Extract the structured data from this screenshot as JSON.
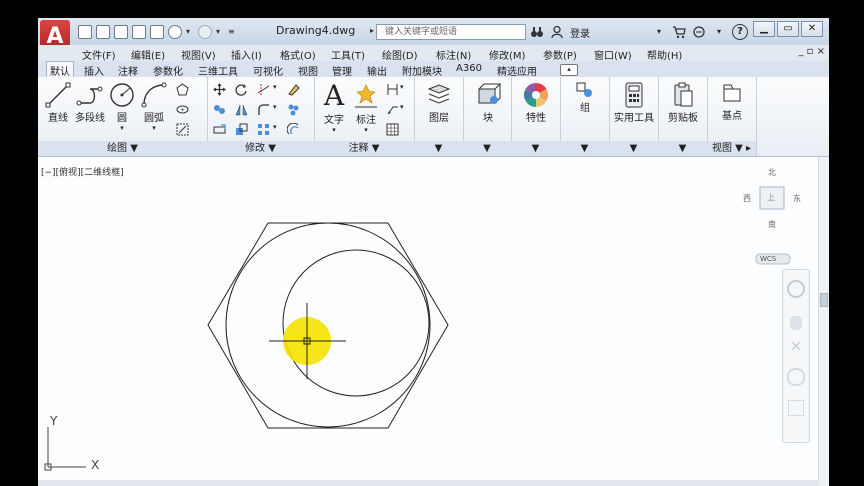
{
  "app": {
    "logo_letter": "A",
    "document_title": "Drawing4.dwg"
  },
  "search": {
    "placeholder": "键入关键字或短语"
  },
  "user": {
    "login_label": "登录"
  },
  "menu": {
    "items": [
      "文件(F)",
      "编辑(E)",
      "视图(V)",
      "插入(I)",
      "格式(O)",
      "工具(T)",
      "绘图(D)",
      "标注(N)",
      "修改(M)",
      "参数(P)",
      "窗口(W)",
      "帮助(H)"
    ],
    "right_controls": "_ ▫ ×"
  },
  "tabs": [
    "默认",
    "插入",
    "注释",
    "参数化",
    "三维工具",
    "可视化",
    "视图",
    "管理",
    "输出",
    "附加模块",
    "A360",
    "精选应用"
  ],
  "ribbon": {
    "draw": {
      "tools": [
        "直线",
        "多段线",
        "圆",
        "圆弧"
      ],
      "footer": "绘图 ▼"
    },
    "modify": {
      "footer": "修改 ▼"
    },
    "annotation": {
      "tools": [
        "文字",
        "标注"
      ],
      "footer": "注释 ▼"
    },
    "layers": {
      "label": "图层",
      "footer": "▼"
    },
    "block": {
      "label": "块",
      "footer": "▼"
    },
    "properties": {
      "label": "特性",
      "footer": "▼"
    },
    "groups": {
      "label": "组",
      "footer": "▼"
    },
    "utilities": {
      "label": "实用工具",
      "footer": "▼"
    },
    "clipboard": {
      "label": "剪贴板",
      "footer": "▼"
    },
    "view": {
      "label": "基点",
      "footer": "视图 ▼ ▸"
    }
  },
  "viewport": {
    "label": "[−][俯视][二维线框]",
    "viewcube": {
      "north": "北",
      "south": "南",
      "east": "东",
      "west": "西",
      "face": "上",
      "wcs": "WCS"
    },
    "ucs": {
      "x": "X",
      "y": "Y"
    }
  }
}
